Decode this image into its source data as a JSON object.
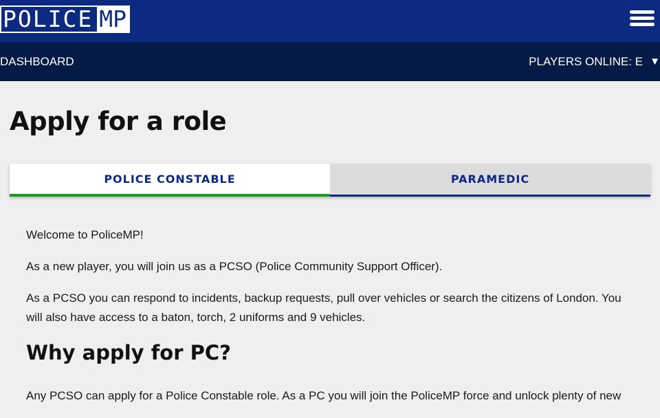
{
  "header": {
    "logo_left": "POLICE",
    "logo_right": "MP"
  },
  "nav": {
    "dashboard": "DASHBOARD",
    "players_online": "PLAYERS ONLINE: E",
    "caret": "▼"
  },
  "page": {
    "title": "Apply for a role"
  },
  "tabs": [
    {
      "label": "POLICE CONSTABLE",
      "active": true
    },
    {
      "label": "PARAMEDIC",
      "active": false
    }
  ],
  "content": {
    "p1": "Welcome to PoliceMP!",
    "p2": "As a new player, you will join us as a PCSO (Police Community Support Officer).",
    "p3": "As a PCSO you can respond to incidents, backup requests, pull over vehicles or search the citizens of London. You will also have access to a baton, torch, 2 uniforms and 9 vehicles.",
    "heading": "Why apply for PC?",
    "p4": "Any PCSO can apply for a Police Constable role. As a PC you will join the PoliceMP force and unlock plenty of new"
  },
  "colors": {
    "header_bg": "#0c2a80",
    "nav_bg": "#061a46",
    "active_tab_underline": "#189c1c",
    "tab_text": "#0c2a80"
  },
  "icons": {
    "menu": "hamburger-menu-icon",
    "dropdown": "caret-down-icon"
  }
}
